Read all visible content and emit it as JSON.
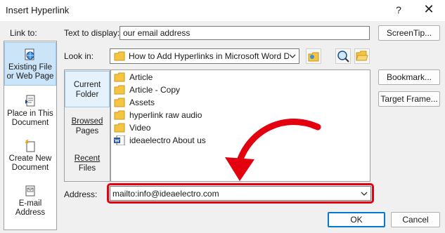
{
  "window": {
    "title": "Insert Hyperlink",
    "help_glyph": "?",
    "close_glyph": "✕"
  },
  "link_to": {
    "label": "Link to:",
    "items": [
      {
        "line1": "Existing File",
        "line2": "or Web Page",
        "icon": "globe-page-icon",
        "active": true
      },
      {
        "line1": "Place in This",
        "line2": "Document",
        "icon": "document-place-icon",
        "active": false
      },
      {
        "line1": "Create New",
        "line2": "Document",
        "icon": "new-document-icon",
        "active": false
      },
      {
        "line1": "E-mail",
        "line2": "Address",
        "icon": "email-icon",
        "active": false
      }
    ]
  },
  "text_to_display": {
    "label": "Text to display:",
    "value": "our email address"
  },
  "screentip_button": "ScreenTip...",
  "look_in": {
    "label": "Look in:",
    "value": "How to Add Hyperlinks in Microsoft Word D"
  },
  "side_tabs": [
    {
      "line1": "Current",
      "line2": "Folder",
      "active": true
    },
    {
      "line1": "Browsed",
      "line2": "Pages",
      "active": false
    },
    {
      "line1": "Recent",
      "line2": "Files",
      "active": false
    }
  ],
  "files": [
    {
      "name": "Article",
      "icon": "folder-icon"
    },
    {
      "name": "Article - Copy",
      "icon": "folder-icon"
    },
    {
      "name": "Assets",
      "icon": "folder-icon"
    },
    {
      "name": "hyperlink raw audio",
      "icon": "folder-icon"
    },
    {
      "name": "Video",
      "icon": "folder-icon"
    },
    {
      "name": "ideaelectro About us",
      "icon": "word-document-icon"
    }
  ],
  "bookmark_button": "Bookmark...",
  "target_frame_button": "Target Frame...",
  "address": {
    "label": "Address:",
    "value": "mailto:info@ideaelectro.com"
  },
  "ok_button": "OK",
  "cancel_button": "Cancel",
  "colors": {
    "highlight_red": "#e3000f",
    "selection_blue": "#cce4f7",
    "folder_yellow": "#f5c542"
  }
}
